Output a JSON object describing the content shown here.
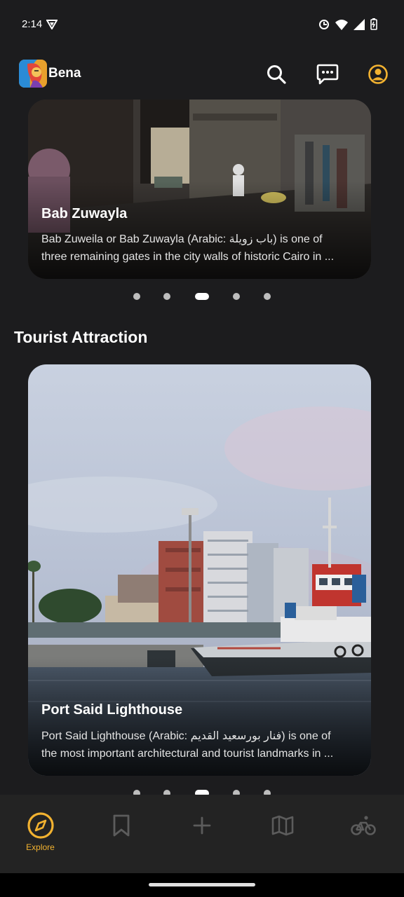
{
  "status_bar": {
    "time": "2:14",
    "icons": [
      "vpn-icon",
      "sync-icon",
      "wifi-icon",
      "signal-icon",
      "battery-icon"
    ]
  },
  "app_bar": {
    "brand": "Bena",
    "actions": [
      "search-icon",
      "chat-icon",
      "account-icon"
    ],
    "accent_color": "#f2b230"
  },
  "top_carousel": {
    "card": {
      "title": "Bab Zuwayla",
      "description_line1": "Bab Zuweila or Bab Zuwayla (Arabic: باب زويلة) is one of",
      "description_line2": "three remaining gates in the city walls of historic Cairo in ..."
    },
    "page_count": 5,
    "active_index": 2
  },
  "tourist_section": {
    "title": "Tourist Attraction",
    "card": {
      "title": "Port Said Lighthouse",
      "description_line1": "Port Said Lighthouse (Arabic: فنار بورسعيد القديم) is one of",
      "description_line2": "the most important architectural and tourist landmarks in ..."
    },
    "page_count": 5,
    "active_index": 2
  },
  "bottom_nav": {
    "items": [
      {
        "icon": "compass-icon",
        "label": "Explore",
        "active": true
      },
      {
        "icon": "bookmark-icon",
        "label": "",
        "active": false
      },
      {
        "icon": "plus-icon",
        "label": "",
        "active": false
      },
      {
        "icon": "map-icon",
        "label": "",
        "active": false
      },
      {
        "icon": "bike-icon",
        "label": "",
        "active": false
      }
    ]
  }
}
